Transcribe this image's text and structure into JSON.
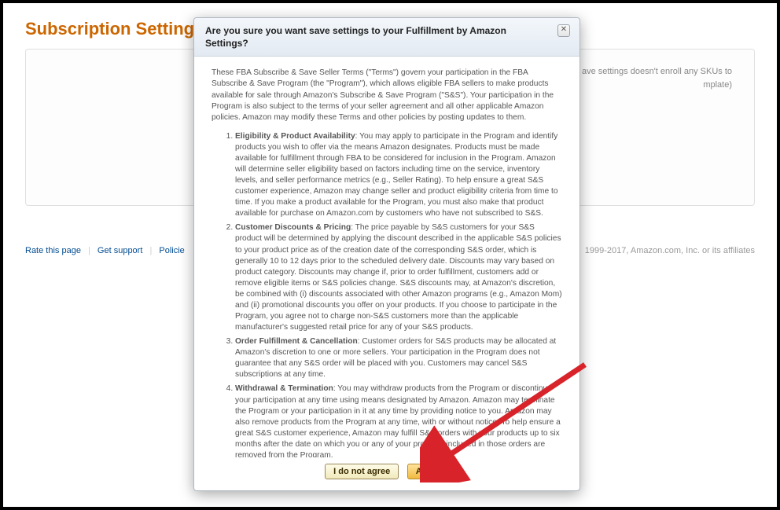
{
  "page": {
    "title": "Subscription Settings",
    "settings_note_line1": "ave settings doesn't enroll any SKUs to",
    "settings_note_line2": "mplate)"
  },
  "footer": {
    "rate": "Rate this page",
    "support": "Get support",
    "policies": "Policie",
    "copyright": "1999-2017, Amazon.com, Inc. or its affiliates"
  },
  "modal": {
    "title": "Are you sure you want save settings to your Fulfillment by Amazon Settings?",
    "close": "✕",
    "intro": "These FBA Subscribe & Save Seller Terms (\"Terms\") govern your participation in the FBA Subscribe & Save Program (the \"Program\"), which allows eligible FBA sellers to make products available for sale through Amazon's Subscribe & Save Program (\"S&S\"). Your participation in the Program is also subject to the terms of your seller agreement and all other applicable Amazon policies. Amazon may modify these Terms and other policies by posting updates to them.",
    "terms": [
      {
        "title": "Eligibility & Product Availability",
        "body": ": You may apply to participate in the Program and identify products you wish to offer via the means Amazon designates. Products must be made available for fulfillment through FBA to be considered for inclusion in the Program. Amazon will determine seller eligibility based on factors including time on the service, inventory levels, and seller performance metrics (e.g., Seller Rating). To help ensure a great S&S customer experience, Amazon may change seller and product eligibility criteria from time to time. If you make a product available for the Program, you must also make that product available for purchase on Amazon.com by customers who have not subscribed to S&S."
      },
      {
        "title": "Customer Discounts & Pricing",
        "body": ": The price payable by S&S customers for your S&S product will be determined by applying the discount described in the applicable S&S policies to your product price as of the creation date of the corresponding S&S order, which is generally 10 to 12 days prior to the scheduled delivery date. Discounts may vary based on product category. Discounts may change if, prior to order fulfillment, customers add or remove eligible items or S&S policies change. S&S discounts may, at Amazon's discretion, be combined with (i) discounts associated with other Amazon programs (e.g., Amazon Mom) and (ii) promotional discounts you offer on your products. If you choose to participate in the Program, you agree not to charge non-S&S customers more than the applicable manufacturer's suggested retail price for any of your S&S products."
      },
      {
        "title": "Order Fulfillment & Cancellation",
        "body": ": Customer orders for S&S products may be allocated at Amazon's discretion to one or more sellers. Your participation in the Program does not guarantee that any S&S order will be placed with you. Customers may cancel S&S subscriptions at any time."
      },
      {
        "title": "Withdrawal & Termination",
        "body": ": You may withdraw products from the Program or discontinue your participation at any time using means designated by Amazon. Amazon may terminate the Program or your participation in it at any time by providing notice to you. Amazon may also remove products from the Program at any time, with or without notice. To help ensure a great S&S customer experience, Amazon may fulfill S&S orders with your products up to six months after the date on which you or any of your products included in those orders are removed from the Program."
      }
    ],
    "disagree_label": "I do not agree",
    "agree_label": "Agree"
  }
}
